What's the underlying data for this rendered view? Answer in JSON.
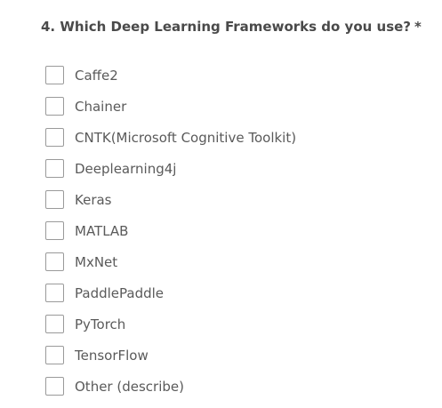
{
  "question": {
    "text": "4. Which Deep Learning Frameworks do you use?",
    "required_marker": "*"
  },
  "options": [
    {
      "label": "Caffe2",
      "checked": false
    },
    {
      "label": "Chainer",
      "checked": false
    },
    {
      "label": "CNTK(Microsoft Cognitive Toolkit)",
      "checked": false
    },
    {
      "label": "Deeplearning4j",
      "checked": false
    },
    {
      "label": "Keras",
      "checked": false
    },
    {
      "label": "MATLAB",
      "checked": false
    },
    {
      "label": "MxNet",
      "checked": false
    },
    {
      "label": "PaddlePaddle",
      "checked": false
    },
    {
      "label": "PyTorch",
      "checked": false
    },
    {
      "label": "TensorFlow",
      "checked": false
    },
    {
      "label": "Other (describe)",
      "checked": false
    }
  ]
}
